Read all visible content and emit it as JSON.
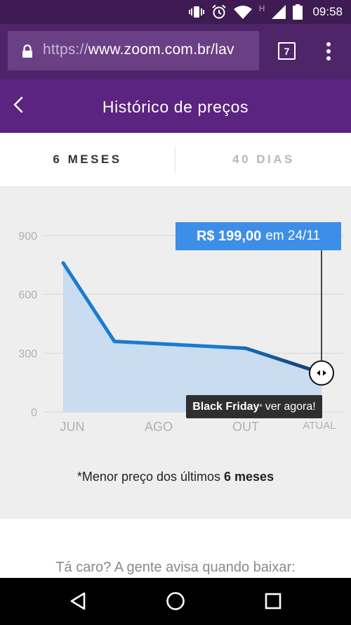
{
  "status_bar": {
    "time": "09:58",
    "icons": [
      "vibrate-icon",
      "alarm-icon",
      "wifi-icon",
      "network-type-icon",
      "signal-icon",
      "battery-icon"
    ],
    "network_type": "H"
  },
  "browser": {
    "url_scheme": "https://",
    "url_host": "www.zoom.com.br/lav",
    "tab_count": "7",
    "icons": [
      "lock-icon",
      "more-vert-icon"
    ]
  },
  "header": {
    "title": "Histórico de preços",
    "back_icon": "chevron-left-icon"
  },
  "tabs": [
    {
      "label": "6 MESES",
      "active": true
    },
    {
      "label": "40 DIAS",
      "active": false
    }
  ],
  "chart_data": {
    "type": "line",
    "title": "",
    "xlabel": "",
    "ylabel": "",
    "categories": [
      "JUN",
      "AGO",
      "OUT",
      "ATUAL"
    ],
    "ylim": [
      0,
      900
    ],
    "yticks": [
      0,
      300,
      600,
      900
    ],
    "series": [
      {
        "points": [
          {
            "x": "JUN",
            "y": 760
          },
          {
            "x": "JUL",
            "y": 360
          },
          {
            "x": "OUT",
            "y": 325
          },
          {
            "x": "ATUAL",
            "y": 199
          }
        ]
      }
    ],
    "fill_under": true,
    "grid": true,
    "colors": {
      "line": "#1a7bcf",
      "line_end": "#0f3d6b",
      "fill": "#c9dcf0",
      "grid": "#d6d6d6"
    },
    "tooltip": {
      "price": "R$ 199,00",
      "date_text": "em 24/11"
    },
    "badge": {
      "strong": "Black Friday",
      "star": "*",
      "cta": "ver agora!"
    }
  },
  "note": {
    "prefix": "*Menor preço dos últimos ",
    "bold": "6 meses"
  },
  "alert": {
    "text": "Tá caro? A gente avisa quando baixar:"
  },
  "nav": {
    "icons": [
      "back-triangle-icon",
      "home-circle-icon",
      "recents-square-icon"
    ]
  },
  "colors": {
    "status_bar": "#3e1b52",
    "browser_bar": "#4f2569",
    "header": "#5a2480",
    "tooltip": "#3d8ee6",
    "badge": "#2f2f2f"
  }
}
